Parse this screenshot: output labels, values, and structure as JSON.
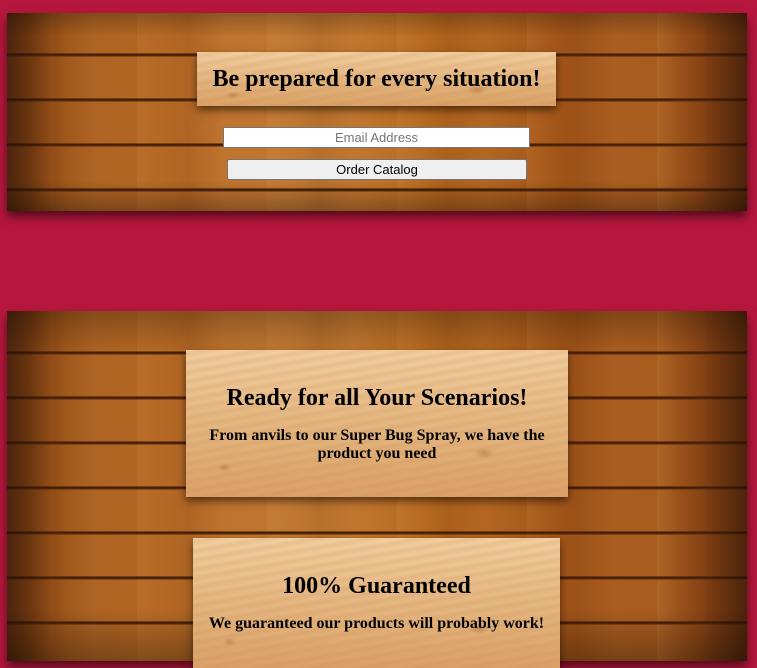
{
  "hero": {
    "title": "Be prepared for every situation!",
    "email_placeholder": "Email Address",
    "email_value": "",
    "order_button_label": "Order Catalog"
  },
  "features": [
    {
      "title": "Ready for all Your Scenarios!",
      "text": "From anvils to our Super Bug Spray, we have the product you need"
    },
    {
      "title": "100% Guaranteed",
      "text": "We guaranteed our products will probably work!"
    }
  ],
  "colors": {
    "page_background": "#b8173d",
    "wood_dark": "#6b2f0b",
    "wood_mid": "#b86a25",
    "panel_light": "#e6ba85"
  }
}
